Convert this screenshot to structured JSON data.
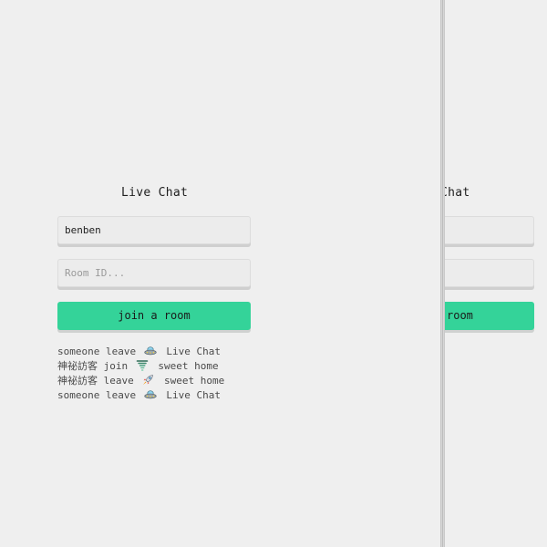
{
  "left_pane": {
    "title": "Live Chat",
    "name_input": {
      "value": "benben",
      "placeholder": ""
    },
    "room_input": {
      "value": "",
      "placeholder": "Room ID..."
    },
    "join_button_label": "join a room",
    "log": [
      {
        "user": "someone",
        "action": "leave",
        "icon": "ufo-icon",
        "room": "Live Chat"
      },
      {
        "user": "神祕訪客",
        "action": "join",
        "icon": "tornado-icon",
        "room": "sweet home"
      },
      {
        "user": "神祕訪客",
        "action": "leave",
        "icon": "rocket-icon",
        "room": "sweet home"
      },
      {
        "user": "someone",
        "action": "leave",
        "icon": "ufo-icon",
        "room": "Live Chat"
      }
    ]
  },
  "right_pane": {
    "title_visible": "Chat",
    "join_button_visible": "room"
  },
  "colors": {
    "background": "#efefef",
    "accent": "#34d399",
    "text": "#1e1e1e",
    "muted_text": "#4a4a4a",
    "placeholder": "#9a9a9a"
  }
}
